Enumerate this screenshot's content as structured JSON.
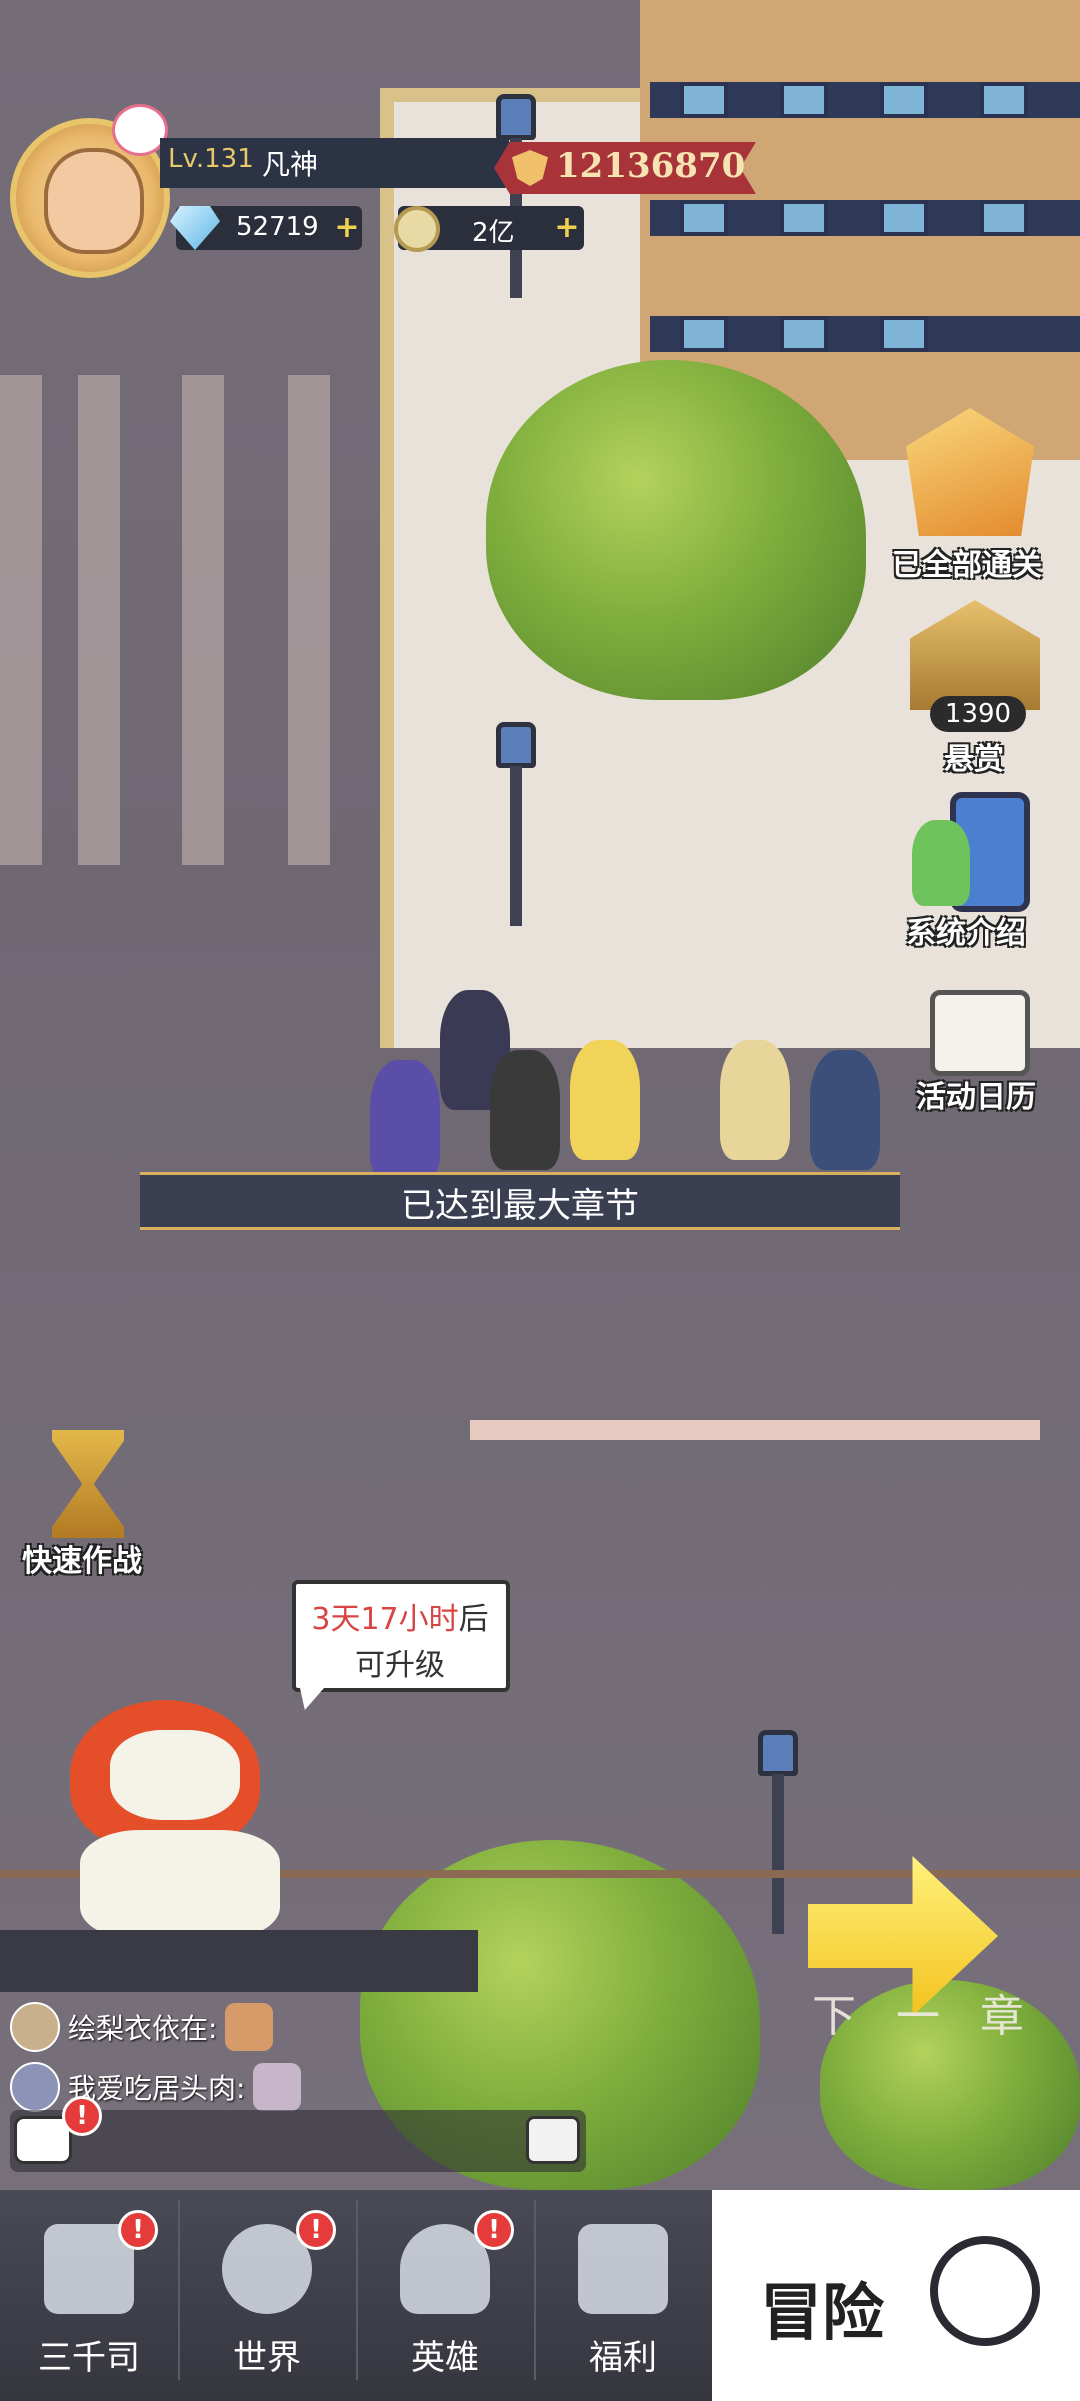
{
  "player": {
    "level": "Lv.131",
    "name": "凡神",
    "combat_power": "12136870",
    "diamonds": "52719",
    "gold": "2亿"
  },
  "side_menu": {
    "all_cleared": "已全部通关",
    "bounty": "悬赏",
    "bounty_count": "1390",
    "system_intro": "系统介绍",
    "event_calendar": "活动日历"
  },
  "stage": {
    "chapter_notice": "已达到最大章节",
    "quick_battle": "快速作战",
    "upgrade_time": "3天17小时",
    "upgrade_suffix": "后",
    "upgrade_line2": "可升级",
    "next_chapter": "下一章"
  },
  "chat": {
    "messages": [
      {
        "user": "绘梨衣依在:"
      },
      {
        "user": "我爱吃居头肉:"
      }
    ],
    "alert": "!"
  },
  "nav": {
    "items": [
      {
        "label": "三千司",
        "badge": "!"
      },
      {
        "label": "世界",
        "badge": "!"
      },
      {
        "label": "英雄",
        "badge": "!"
      },
      {
        "label": "福利"
      }
    ],
    "active_label": "冒险"
  },
  "colors": {
    "accent_gold": "#e7c96a",
    "power_banner": "#a8343a",
    "alert_red": "#e63b3b",
    "countdown_red": "#d84545"
  }
}
